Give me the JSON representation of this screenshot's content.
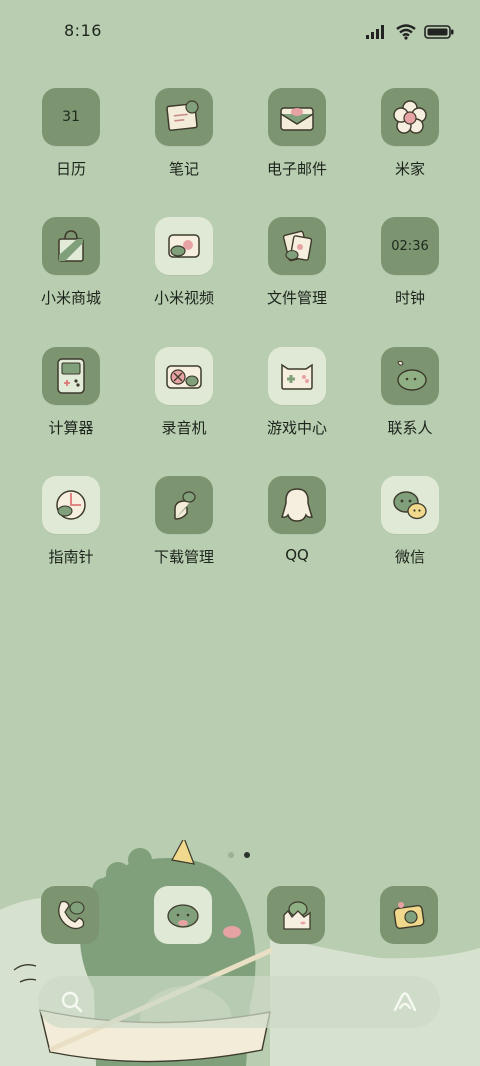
{
  "status_bar": {
    "time": "8:16",
    "icons": [
      "signal-icon",
      "wifi-icon",
      "battery-icon"
    ]
  },
  "apps": [
    {
      "label": "日历",
      "icon": "calendar-icon",
      "tile_text": "31"
    },
    {
      "label": "笔记",
      "icon": "notes-icon"
    },
    {
      "label": "电子邮件",
      "icon": "email-icon"
    },
    {
      "label": "米家",
      "icon": "mijia-flower-icon"
    },
    {
      "label": "小米商城",
      "icon": "shopping-bag-icon"
    },
    {
      "label": "小米视频",
      "icon": "video-player-icon"
    },
    {
      "label": "文件管理",
      "icon": "files-icon"
    },
    {
      "label": "时钟",
      "icon": "clock-icon",
      "tile_text": "02:36"
    },
    {
      "label": "计算器",
      "icon": "calculator-icon"
    },
    {
      "label": "录音机",
      "icon": "recorder-icon"
    },
    {
      "label": "游戏中心",
      "icon": "gamepad-icon"
    },
    {
      "label": "联系人",
      "icon": "contacts-dino-icon"
    },
    {
      "label": "指南针",
      "icon": "compass-icon"
    },
    {
      "label": "下载管理",
      "icon": "download-icon"
    },
    {
      "label": "QQ",
      "icon": "qq-penguin-icon"
    },
    {
      "label": "微信",
      "icon": "wechat-icon"
    }
  ],
  "page_indicator": {
    "pages": 2,
    "current": 2
  },
  "dock": [
    {
      "icon": "phone-icon"
    },
    {
      "icon": "messages-icon"
    },
    {
      "icon": "gallery-icon"
    },
    {
      "icon": "camera-icon"
    }
  ],
  "search_bar": {
    "icons": [
      "search-icon",
      "assistant-icon"
    ]
  },
  "colors": {
    "background": "#b9cdb0",
    "tile_dark": "#7c9470",
    "tile_light": "#dfe9d5",
    "dino_green": "#7fa07a",
    "text": "#1c241c"
  }
}
